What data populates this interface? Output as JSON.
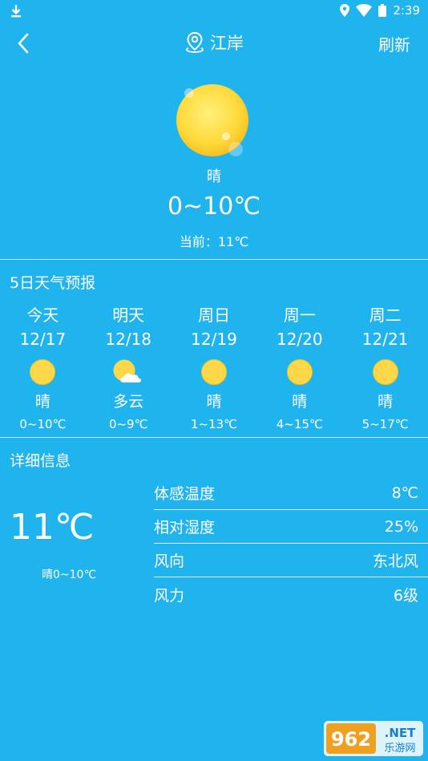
{
  "status_bar": {
    "time": "2:39"
  },
  "header": {
    "city": "江岸",
    "refresh_label": "刷新"
  },
  "today": {
    "condition": "晴",
    "range": "0~10℃",
    "current": "当前：11℃"
  },
  "forecast": {
    "title": "5日天气预报",
    "days": [
      {
        "day": "今天",
        "date": "12/17",
        "icon": "sun-icon",
        "condition": "晴",
        "range": "0~10℃"
      },
      {
        "day": "明天",
        "date": "12/18",
        "icon": "partly-cloudy-icon",
        "condition": "多云",
        "range": "0~9℃"
      },
      {
        "day": "周日",
        "date": "12/19",
        "icon": "sun-icon",
        "condition": "晴",
        "range": "1~13℃"
      },
      {
        "day": "周一",
        "date": "12/20",
        "icon": "sun-icon",
        "condition": "晴",
        "range": "4~15℃"
      },
      {
        "day": "周二",
        "date": "12/21",
        "icon": "sun-icon",
        "condition": "晴",
        "range": "5~17℃"
      }
    ]
  },
  "details": {
    "title": "详细信息",
    "temp": "11℃",
    "summary": "晴0~10℃",
    "rows": [
      {
        "label": "体感温度",
        "value": "8℃"
      },
      {
        "label": "相对湿度",
        "value": "25%"
      },
      {
        "label": "风向",
        "value": "东北风"
      },
      {
        "label": "风力",
        "value": "6级"
      }
    ]
  },
  "watermark": {
    "text": "962.NET",
    "subtext": "乐游网"
  },
  "colors": {
    "background": "#1fb4ee",
    "sun": "#ffd84a",
    "text": "#ffffff"
  }
}
